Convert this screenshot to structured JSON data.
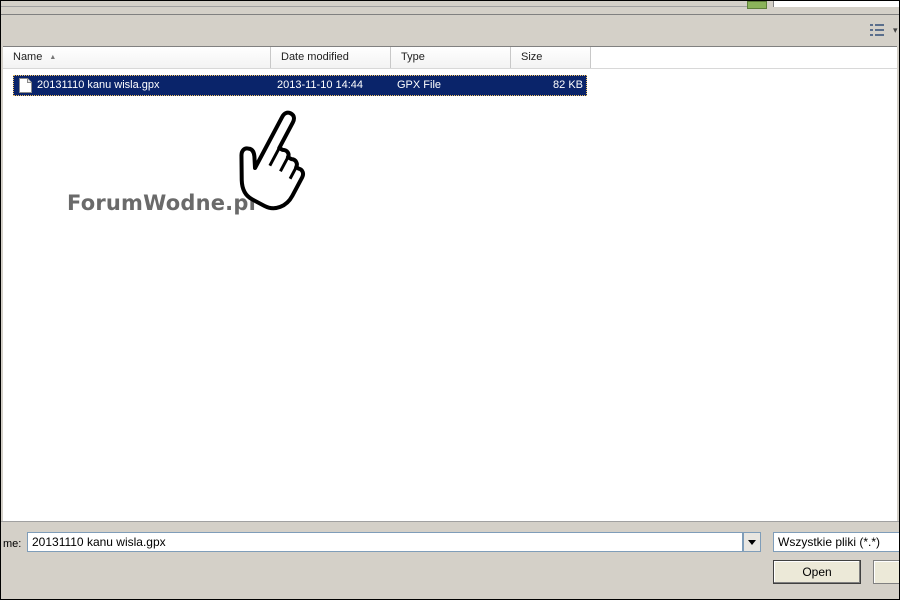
{
  "columns": {
    "name": "Name",
    "date_modified": "Date modified",
    "type": "Type",
    "size": "Size"
  },
  "files": [
    {
      "name": "20131110 kanu wisla.gpx",
      "date_modified": "2013-11-10 14:44",
      "type": "GPX File",
      "size": "82 KB",
      "selected": true
    }
  ],
  "watermark": "ForumWodne.pl",
  "filename": {
    "label": "me:",
    "value": "20131110 kanu wisla.gpx"
  },
  "file_type": {
    "selected": "Wszystkie pliki (*.*)"
  },
  "buttons": {
    "open": "Open"
  },
  "icons": {
    "view": "view-menu-icon",
    "file": "file-icon",
    "sort": "sort-up-icon",
    "cursor": "hand-pointer-icon"
  },
  "colors": {
    "selection": "#0a246a",
    "chrome": "#d4d0c8",
    "watermark": "#6a6a6a"
  }
}
